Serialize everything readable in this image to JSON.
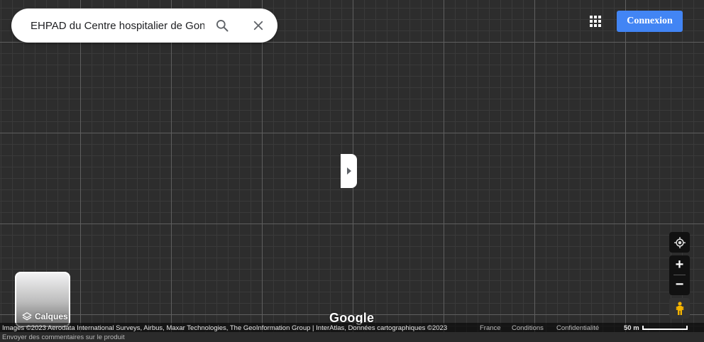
{
  "search": {
    "value": "EHPAD du Centre hospitalier de Gonesse",
    "search_icon": "search-icon",
    "clear_icon": "close-icon"
  },
  "header": {
    "apps_icon": "apps-grid-icon",
    "signin_label": "Connexion"
  },
  "map": {
    "collapse_icon": "chevron-right-icon",
    "layers_label": "Calques",
    "layers_icon": "layers-icon",
    "logo_text": "Google"
  },
  "controls": {
    "locate_icon": "my-location-icon",
    "zoom_in_label": "+",
    "zoom_out_label": "−",
    "pegman_icon": "pegman-icon"
  },
  "footer": {
    "attribution": "Images ©2023 Aerodata International Surveys, Airbus, Maxar Technologies, The GeoInformation Group | InterAtlas, Données cartographiques ©2023",
    "country": "France",
    "terms": "Conditions",
    "privacy": "Confidentialité",
    "scale_label": "50 m",
    "feedback": "Envoyer des commentaires sur le produit"
  },
  "colors": {
    "accent": "#4285f4",
    "map_background": "#2d2d2d"
  }
}
